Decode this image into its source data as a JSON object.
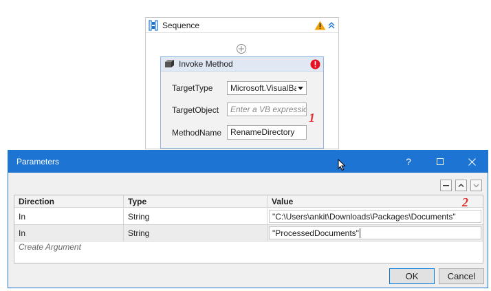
{
  "sequence": {
    "title": "Sequence"
  },
  "invoke": {
    "title": "Invoke Method",
    "target_type_label": "TargetType",
    "target_type_value": "Microsoft.VisualBa",
    "target_object_label": "TargetObject",
    "target_object_placeholder": "Enter a VB expression",
    "method_name_label": "MethodName",
    "method_name_value": "RenameDirectory"
  },
  "annotations": {
    "one": "1",
    "two": "2"
  },
  "dialog": {
    "title": "Parameters",
    "help": "?",
    "columns": [
      "Direction",
      "Type",
      "Value"
    ],
    "rows": [
      {
        "direction": "In",
        "type": "String",
        "value": "\"C:\\Users\\ankit\\Downloads\\Packages\\Documents\""
      },
      {
        "direction": "In",
        "type": "String",
        "value": "\"ProcessedDocuments\""
      }
    ],
    "create_argument": "Create Argument",
    "ok_label": "OK",
    "cancel_label": "Cancel"
  },
  "colors": {
    "titlebar": "#1e74d2",
    "annotation": "#e03030",
    "warning": "#f0a30a",
    "error": "#e81123"
  }
}
